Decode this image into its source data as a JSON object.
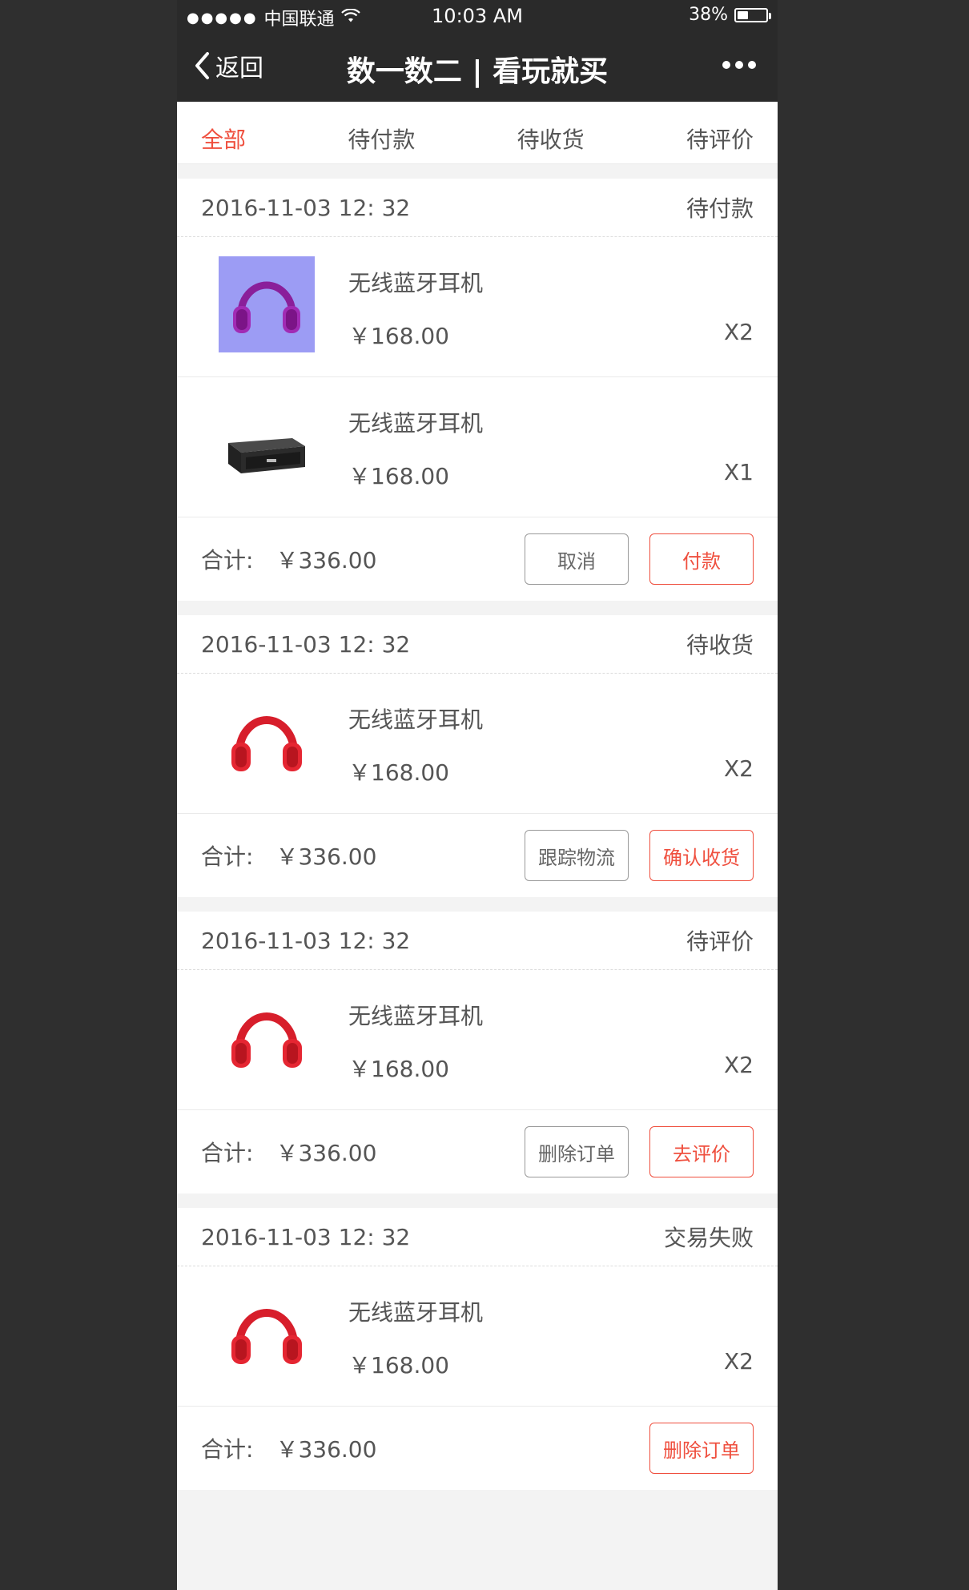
{
  "status_bar": {
    "signal": "●●●●●",
    "carrier": "中国联通",
    "time": "10:03 AM",
    "battery": "38%",
    "battery_level": 0.38
  },
  "nav": {
    "back_label": "返回",
    "title": "数一数二 | 看玩就买"
  },
  "tabs": [
    {
      "label": "全部",
      "active": true
    },
    {
      "label": "待付款",
      "active": false
    },
    {
      "label": "待收货",
      "active": false
    },
    {
      "label": "待评价",
      "active": false
    }
  ],
  "orders": [
    {
      "date": "2016-11-03 12: 32",
      "status": "待付款",
      "products": [
        {
          "name": "无线蓝牙耳机",
          "price": "￥168.00",
          "qty": "X2",
          "image": "purple-headphones"
        },
        {
          "name": "无线蓝牙耳机",
          "price": "￥168.00",
          "qty": "X1",
          "image": "speaker"
        }
      ],
      "total_label": "合计:",
      "total_value": "￥336.00",
      "buttons": [
        {
          "label": "取消",
          "primary": false
        },
        {
          "label": "付款",
          "primary": true
        }
      ]
    },
    {
      "date": "2016-11-03 12: 32",
      "status": "待收货",
      "products": [
        {
          "name": "无线蓝牙耳机",
          "price": "￥168.00",
          "qty": "X2",
          "image": "red-headphones"
        }
      ],
      "total_label": "合计:",
      "total_value": "￥336.00",
      "buttons": [
        {
          "label": "跟踪物流",
          "primary": false
        },
        {
          "label": "确认收货",
          "primary": true
        }
      ]
    },
    {
      "date": "2016-11-03 12: 32",
      "status": "待评价",
      "products": [
        {
          "name": "无线蓝牙耳机",
          "price": "￥168.00",
          "qty": "X2",
          "image": "red-headphones"
        }
      ],
      "total_label": "合计:",
      "total_value": "￥336.00",
      "buttons": [
        {
          "label": "删除订单",
          "primary": false
        },
        {
          "label": "去评价",
          "primary": true
        }
      ]
    },
    {
      "date": "2016-11-03 12: 32",
      "status": "交易失败",
      "products": [
        {
          "name": "无线蓝牙耳机",
          "price": "￥168.00",
          "qty": "X2",
          "image": "red-headphones"
        }
      ],
      "total_label": "合计:",
      "total_value": "￥336.00",
      "buttons": [
        {
          "label": "删除订单",
          "primary": true
        }
      ]
    }
  ],
  "colors": {
    "accent": "#ef4f3e",
    "text": "#555555",
    "button_text": "#666666",
    "border": "#eaeaea",
    "topbar": "#2a2a2a"
  }
}
